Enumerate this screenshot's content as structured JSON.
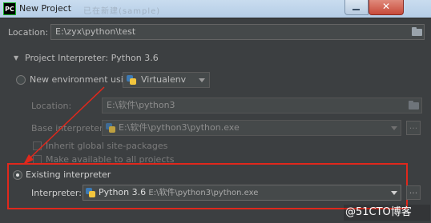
{
  "window": {
    "app_icon_text": "PC",
    "title": "New Project",
    "title_ghost": "已在新建(sample)"
  },
  "location": {
    "label": "Location:",
    "value": "E:\\zyx\\python\\test"
  },
  "interpreter_section": {
    "header": "Project Interpreter: Python 3.6"
  },
  "new_env": {
    "label": "New environment using",
    "tool": "Virtualenv",
    "location_label": "Location:",
    "location_value": "E:\\软件\\python3",
    "base_label": "Base interpreter:",
    "base_value": "E:\\软件\\python3\\python.exe",
    "inherit_label": "Inherit global site-packages",
    "available_label": "Make available to all projects"
  },
  "existing": {
    "label": "Existing interpreter",
    "interpreter_label": "Interpreter:",
    "interpreter_name": "Python 3.6",
    "interpreter_path": "E:\\软件\\python3\\python.exe",
    "more_button": "...",
    "selected": true
  },
  "watermark": "@51CTO博客",
  "colors": {
    "background": "#3c3f41",
    "highlight_border": "#e0281c",
    "annotation_arrow": "#e0281c"
  }
}
